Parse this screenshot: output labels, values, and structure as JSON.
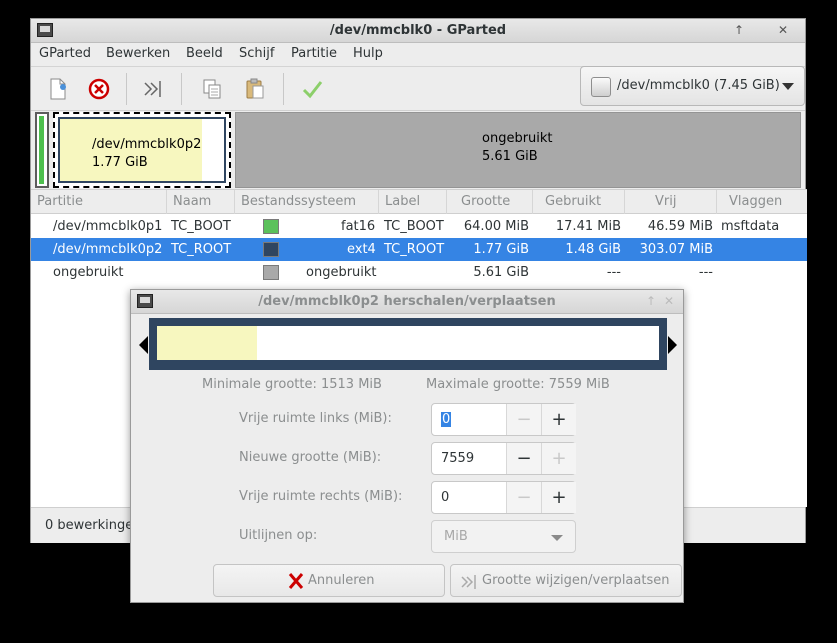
{
  "window": {
    "title": "/dev/mmcblk0 - GParted"
  },
  "menu": [
    "GParted",
    "Bewerken",
    "Beeld",
    "Schijf",
    "Partitie",
    "Hulp"
  ],
  "device_selector": {
    "label": "/dev/mmcblk0 (7.45 GiB)"
  },
  "disk_map": {
    "p2_name": "/dev/mmcblk0p2",
    "p2_size": "1.77 GiB",
    "free_name": "ongebruikt",
    "free_size": "5.61 GiB"
  },
  "table": {
    "headers": [
      "Partitie",
      "Naam",
      "Bestandssysteem",
      "Label",
      "Grootte",
      "Gebruikt",
      "Vrij",
      "Vlaggen"
    ],
    "rows": [
      {
        "partition": "/dev/mmcblk0p1",
        "name": "TC_BOOT",
        "fs": "fat16",
        "label": "TC_BOOT",
        "size": "64.00 MiB",
        "used": "17.41 MiB",
        "free": "46.59 MiB",
        "flags": "msftdata",
        "color": "#5bc15b",
        "selected": false
      },
      {
        "partition": "/dev/mmcblk0p2",
        "name": "TC_ROOT",
        "fs": "ext4",
        "label": "TC_ROOT",
        "size": "1.77 GiB",
        "used": "1.48 GiB",
        "free": "303.07 MiB",
        "flags": "",
        "color": "#2f4560",
        "selected": true
      },
      {
        "partition": "ongebruikt",
        "name": "",
        "fs": "ongebruikt",
        "label": "",
        "size": "5.61 GiB",
        "used": "---",
        "free": "---",
        "flags": "",
        "color": "#a9a9a9",
        "selected": false
      }
    ]
  },
  "status": {
    "text": "0 bewerkinge"
  },
  "dialog": {
    "title": "/dev/mmcblk0p2 herschalen/verplaatsen",
    "min_size": "Minimale grootte: 1513 MiB",
    "max_size": "Maximale grootte: 7559 MiB",
    "fields": {
      "free_before_label": "Vrije ruimte links (MiB):",
      "free_before_value": "0",
      "new_size_label": "Nieuwe grootte (MiB):",
      "new_size_value": "7559",
      "free_after_label": "Vrije ruimte rechts (MiB):",
      "free_after_value": "0",
      "align_label": "Uitlijnen op:",
      "align_value": "MiB"
    },
    "cancel_label": "Annuleren",
    "apply_label": "Grootte wijzigen/verplaatsen"
  },
  "colors": {
    "selection": "#3584e4",
    "ext4": "#2f4560",
    "fat16": "#5bc15b",
    "used": "#f7f7bf",
    "unallocated": "#a9a9a9"
  }
}
